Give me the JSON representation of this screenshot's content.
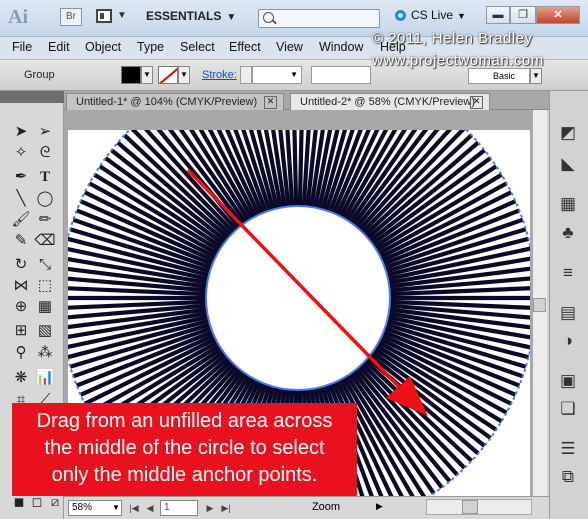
{
  "titlebar": {
    "logo": "Ai",
    "bridge_label": "Br",
    "workspace": "ESSENTIALS",
    "search_placeholder": "",
    "cs_live": "CS Live"
  },
  "menu": [
    "File",
    "Edit",
    "Object",
    "Type",
    "Select",
    "Effect",
    "View",
    "Window",
    "Help"
  ],
  "watermark": {
    "line1": "© 2011, Helen Bradley",
    "line2": "www.projectwoman.com"
  },
  "controlbar": {
    "selection_label": "Group",
    "stroke_label": "Stroke:",
    "style_label": "Basic"
  },
  "tabs": [
    {
      "label": "Untitled-1* @ 104% (CMYK/Preview)",
      "active": false
    },
    {
      "label": "Untitled-2* @ 58% (CMYK/Preview)",
      "active": true
    }
  ],
  "statusbar": {
    "zoom": "58%",
    "page": "1",
    "status": "Zoom"
  },
  "caption": {
    "line1": "Drag from an unfilled area across",
    "line2": "the middle of the circle to select",
    "line3": "only the middle anchor points."
  },
  "colors": {
    "caption_bg": "#e8111d",
    "arrow": "#ee1111",
    "selection": "#4a7cf0",
    "cs_live": "#2088d8"
  }
}
